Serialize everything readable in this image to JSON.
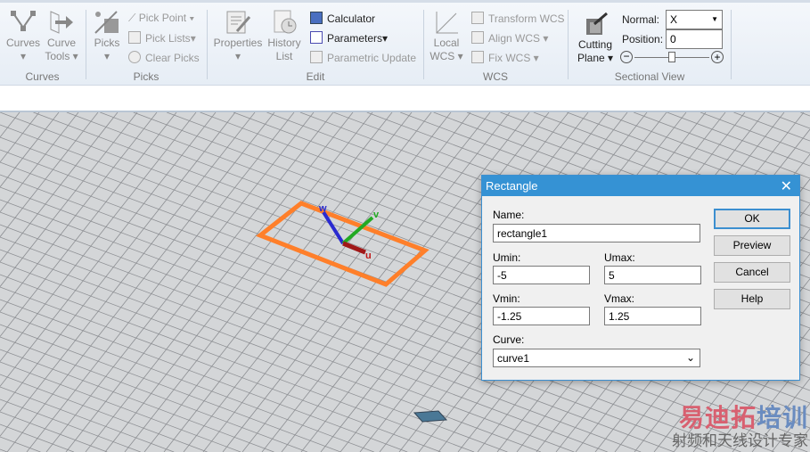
{
  "ribbon": {
    "curves_group": {
      "label": "Curves",
      "curves": "Curves",
      "curve_tools_1": "Curve",
      "curve_tools_2": "Tools"
    },
    "picks_group": {
      "label": "Picks",
      "picks": "Picks",
      "pick_point": "Pick Point",
      "pick_lists": "Pick Lists",
      "clear_picks": "Clear Picks"
    },
    "edit_group": {
      "label": "Edit",
      "properties": "Properties",
      "history_1": "History",
      "history_2": "List",
      "calculator": "Calculator",
      "parameters": "Parameters",
      "parametric_update": "Parametric Update"
    },
    "wcs_group": {
      "label": "WCS",
      "local_1": "Local",
      "local_2": "WCS",
      "transform": "Transform WCS",
      "align": "Align WCS",
      "fix": "Fix WCS"
    },
    "sectional_group": {
      "label": "Sectional View",
      "cutting_1": "Cutting",
      "cutting_2": "Plane",
      "normal_label": "Normal:",
      "normal_value": "X",
      "position_label": "Position:",
      "position_value": "0",
      "slider_value": 0.5
    }
  },
  "axes": {
    "w": "w",
    "v": "v",
    "u": "u"
  },
  "dialog": {
    "title": "Rectangle",
    "name_label": "Name:",
    "name_value": "rectangle1",
    "umin_label": "Umin:",
    "umin_value": "-5",
    "umax_label": "Umax:",
    "umax_value": "5",
    "vmin_label": "Vmin:",
    "vmin_value": "-1.25",
    "vmax_label": "Vmax:",
    "vmax_value": "1.25",
    "curve_label": "Curve:",
    "curve_value": "curve1",
    "ok": "OK",
    "preview": "Preview",
    "cancel": "Cancel",
    "help": "Help"
  },
  "watermark": {
    "line1a": "易迪拓",
    "line1b": "培训",
    "line2": "射频和天线设计专家"
  },
  "colors": {
    "accent": "#3592d4",
    "rectangle": "#ff7f2a"
  }
}
